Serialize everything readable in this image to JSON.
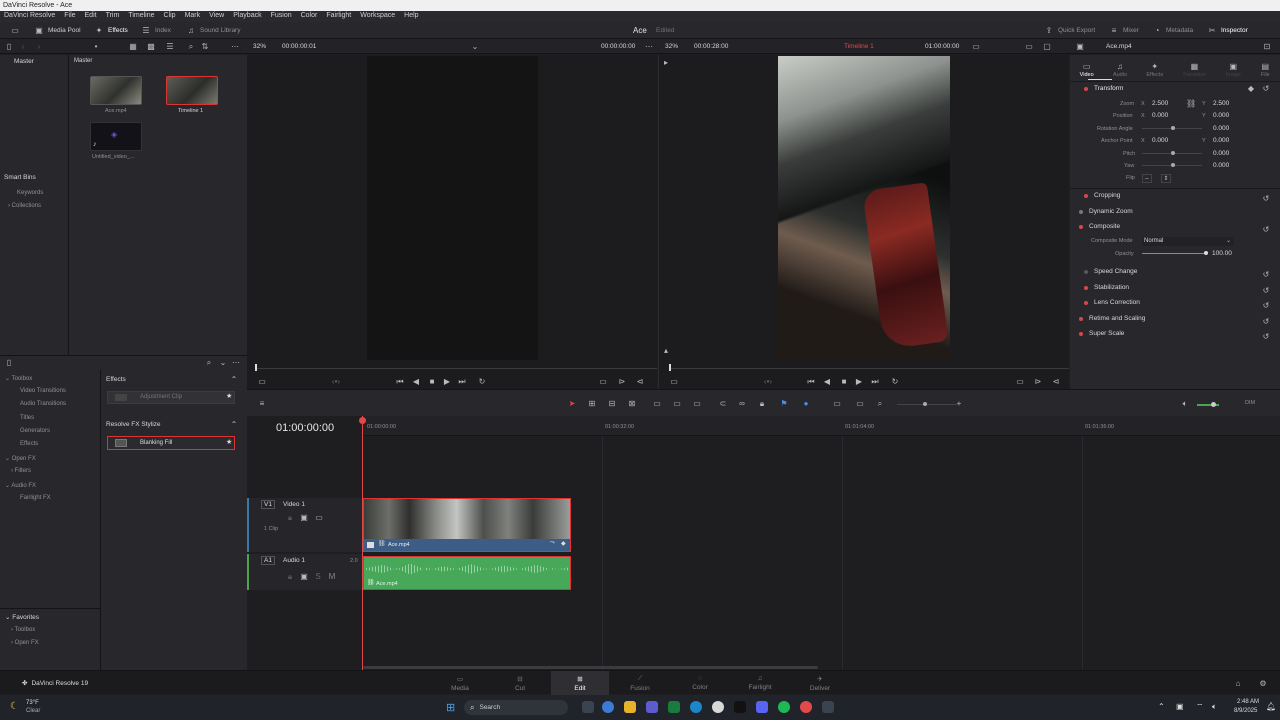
{
  "window": {
    "title": "DaVinci Resolve - Ace"
  },
  "menu": [
    "DaVinci Resolve",
    "File",
    "Edit",
    "Trim",
    "Timeline",
    "Clip",
    "Mark",
    "View",
    "Playback",
    "Fusion",
    "Color",
    "Fairlight",
    "Workspace",
    "Help"
  ],
  "toolbar": {
    "media_pool": "Media Pool",
    "effects": "Effects",
    "index": "Index",
    "sound_library": "Sound Library",
    "project": "Ace",
    "status": "Edited",
    "quick_export": "Quick Export",
    "mixer": "Mixer",
    "metadata": "Metadata",
    "inspector": "Inspector"
  },
  "viewer_bar": {
    "src_zoom": "32%",
    "src_tc": "00:00:00:01",
    "src_tc2": "00:00:00:00",
    "prg_zoom": "32%",
    "prg_dur": "00:00:28:00",
    "timeline_name": "Timeline 1",
    "prg_tc": "01:00:00:00",
    "clip_name": "Ace.mp4"
  },
  "media": {
    "bin_master": "Master",
    "pool_master": "Master",
    "clips": [
      {
        "name": "Ace.mp4"
      },
      {
        "name": "Timeline 1"
      },
      {
        "name": "Untitled_video_..."
      }
    ],
    "smart_bins": "Smart Bins",
    "smart_items": [
      "Keywords",
      "Collections"
    ]
  },
  "effects_tree": {
    "items": [
      "Toolbox",
      "Video Transitions",
      "Audio Transitions",
      "Titles",
      "Generators",
      "Effects",
      "Open FX",
      "Filters",
      "Audio FX",
      "Fairlight FX"
    ],
    "favorites": "Favorites",
    "fav_items": [
      "Toolbox",
      "Open FX"
    ]
  },
  "effects_list": {
    "section1": "Effects",
    "item1": "Adjustment Clip",
    "section2": "Resolve FX Stylize",
    "item2": "Blanking Fill"
  },
  "inspector": {
    "tabs": [
      "Video",
      "Audio",
      "Effects",
      "Transition",
      "Image",
      "File"
    ],
    "transform": "Transform",
    "zoom_label": "Zoom",
    "zoom_x": "2.500",
    "zoom_y": "2.500",
    "position_label": "Position",
    "pos_x": "0.000",
    "pos_y": "0.000",
    "rotation_label": "Rotation Angle",
    "rotation": "0.000",
    "anchor_label": "Anchor Point",
    "anchor_x": "0.000",
    "anchor_y": "0.000",
    "pitch_label": "Pitch",
    "pitch": "0.000",
    "yaw_label": "Yaw",
    "yaw": "0.000",
    "flip_label": "Flip",
    "x_axis": "X",
    "y_axis": "Y",
    "cropping": "Cropping",
    "dynamic_zoom": "Dynamic Zoom",
    "composite": "Composite",
    "composite_mode_label": "Composite Mode",
    "composite_mode": "Normal",
    "opacity_label": "Opacity",
    "opacity": "100.00",
    "speed_change": "Speed Change",
    "stabilization": "Stabilization",
    "lens_correction": "Lens Correction",
    "retime": "Retime and Scaling",
    "super_scale": "Super Scale"
  },
  "timeline": {
    "timecode": "01:00:00:00",
    "ruler": [
      "01:00:00:00",
      "01:00:32:00",
      "01:01:04:00",
      "01:01:36:00"
    ],
    "v1_tag": "V1",
    "v1_name": "Video 1",
    "v1_clips": "1 Clip",
    "v1_clip": "Ace.mp4",
    "a1_tag": "A1",
    "a1_name": "Audio 1",
    "a1_ch": "2.0",
    "a1_clip": "Ace.mp4",
    "dim": "DIM"
  },
  "pages": [
    "Media",
    "Cut",
    "Edit",
    "Fusion",
    "Color",
    "Fairlight",
    "Deliver"
  ],
  "app_version": "DaVinci Resolve 19",
  "taskbar": {
    "temp": "73°F",
    "weather": "Clear",
    "search": "Search",
    "time": "2:48 AM",
    "date": "8/9/2025"
  }
}
